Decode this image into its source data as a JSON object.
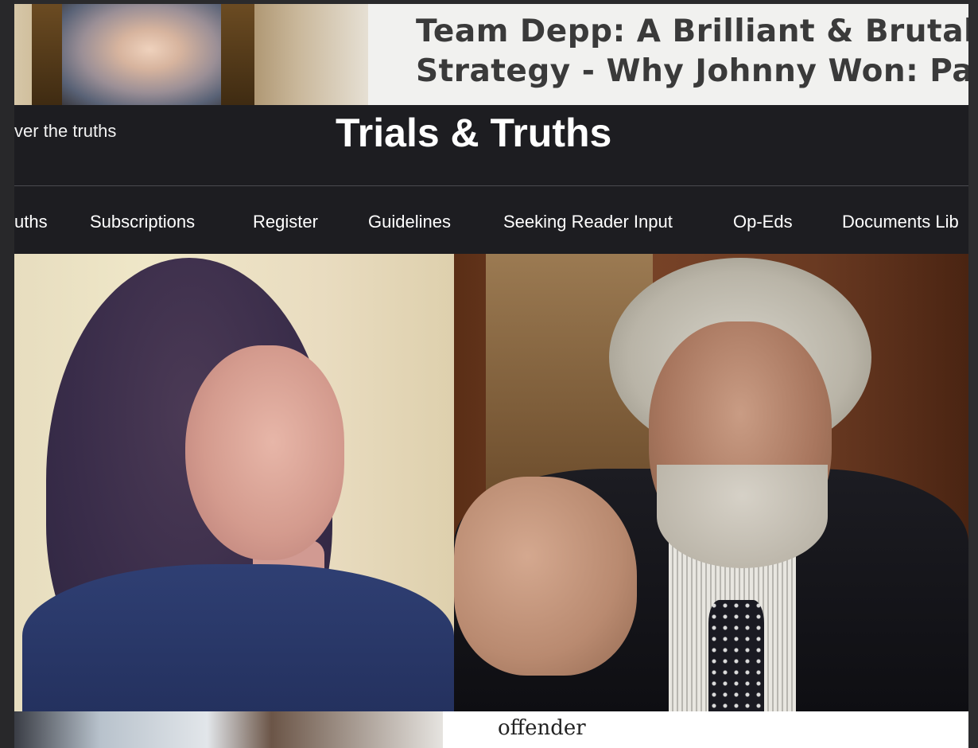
{
  "banner": {
    "title_line1": "Team Depp: A Brilliant & Brutal L",
    "title_line2": "Strategy - Why Johnny Won: Pa"
  },
  "header": {
    "tagline": "ver the truths",
    "site_title": "Trials & Truths"
  },
  "nav": {
    "items": [
      {
        "label": "uths"
      },
      {
        "label": "Subscriptions"
      },
      {
        "label": "Register"
      },
      {
        "label": "Guidelines"
      },
      {
        "label": "Seeking Reader Input"
      },
      {
        "label": "Op-Eds"
      },
      {
        "label": "Documents Lib"
      }
    ]
  },
  "article_preview": {
    "excerpt": "offender"
  },
  "colors": {
    "header_bg": "#1d1d21",
    "header_text": "#ffffff"
  }
}
